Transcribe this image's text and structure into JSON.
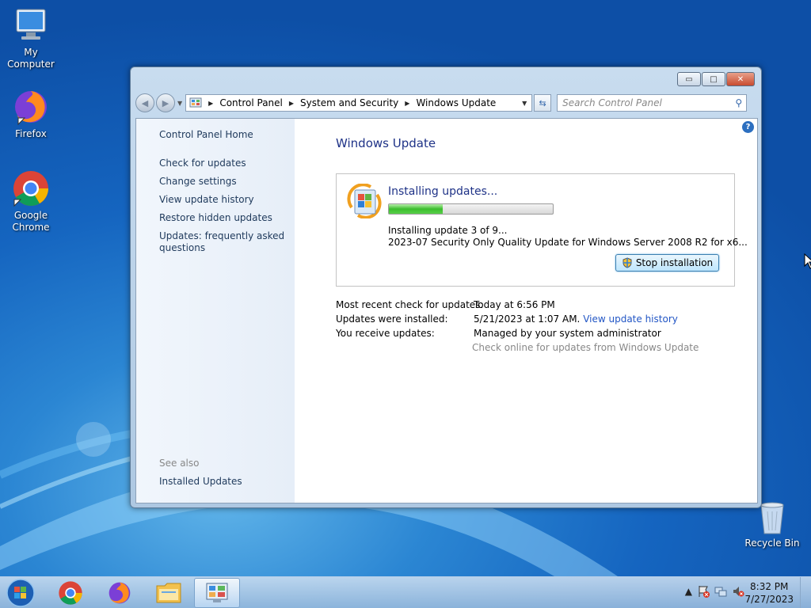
{
  "desktop": {
    "icons": [
      {
        "label": "My Computer",
        "icon": "computer-icon"
      },
      {
        "label": "Firefox",
        "icon": "firefox-icon"
      },
      {
        "label": "Google Chrome",
        "icon": "chrome-icon"
      },
      {
        "label": "Recycle Bin",
        "icon": "recycle-bin-icon"
      }
    ]
  },
  "window": {
    "controls": {
      "minimize": "▭",
      "maximize": "□",
      "close": "✕"
    },
    "address": {
      "crumbs": [
        "Control Panel",
        "System and Security",
        "Windows Update"
      ]
    },
    "search": {
      "placeholder": "Search Control Panel"
    },
    "sidebar": {
      "home": "Control Panel Home",
      "links": [
        "Check for updates",
        "Change settings",
        "View update history",
        "Restore hidden updates",
        "Updates: frequently asked questions"
      ],
      "see_also": "See also",
      "installed_updates": "Installed Updates"
    },
    "main": {
      "title": "Windows Update",
      "status": {
        "heading": "Installing updates...",
        "progress_fraction": 0.33,
        "step": "Installing update 3 of 9...",
        "update_name": "2023-07 Security Only Quality Update for Windows Server 2008 R2 for x6...",
        "stop_button": "Stop installation"
      },
      "info": {
        "recent_check_label": "Most recent check for updates:",
        "recent_check_value": "Today at 6:56 PM",
        "installed_label": "Updates were installed:",
        "installed_value": "5/21/2023 at 1:07 AM.",
        "history_link": "View update history",
        "receive_label": "You receive updates:",
        "receive_value": "Managed by your system administrator",
        "check_online": "Check online for updates from Windows Update"
      }
    }
  },
  "taskbar": {
    "apps": [
      "chrome-icon",
      "firefox-icon",
      "file-explorer-icon",
      "control-panel-icon"
    ],
    "clock": {
      "time": "8:32 PM",
      "date": "7/27/2023"
    }
  },
  "colors": {
    "accent_title": "#1e3287",
    "link": "#2256c5",
    "progress": "#3cbd2e"
  }
}
